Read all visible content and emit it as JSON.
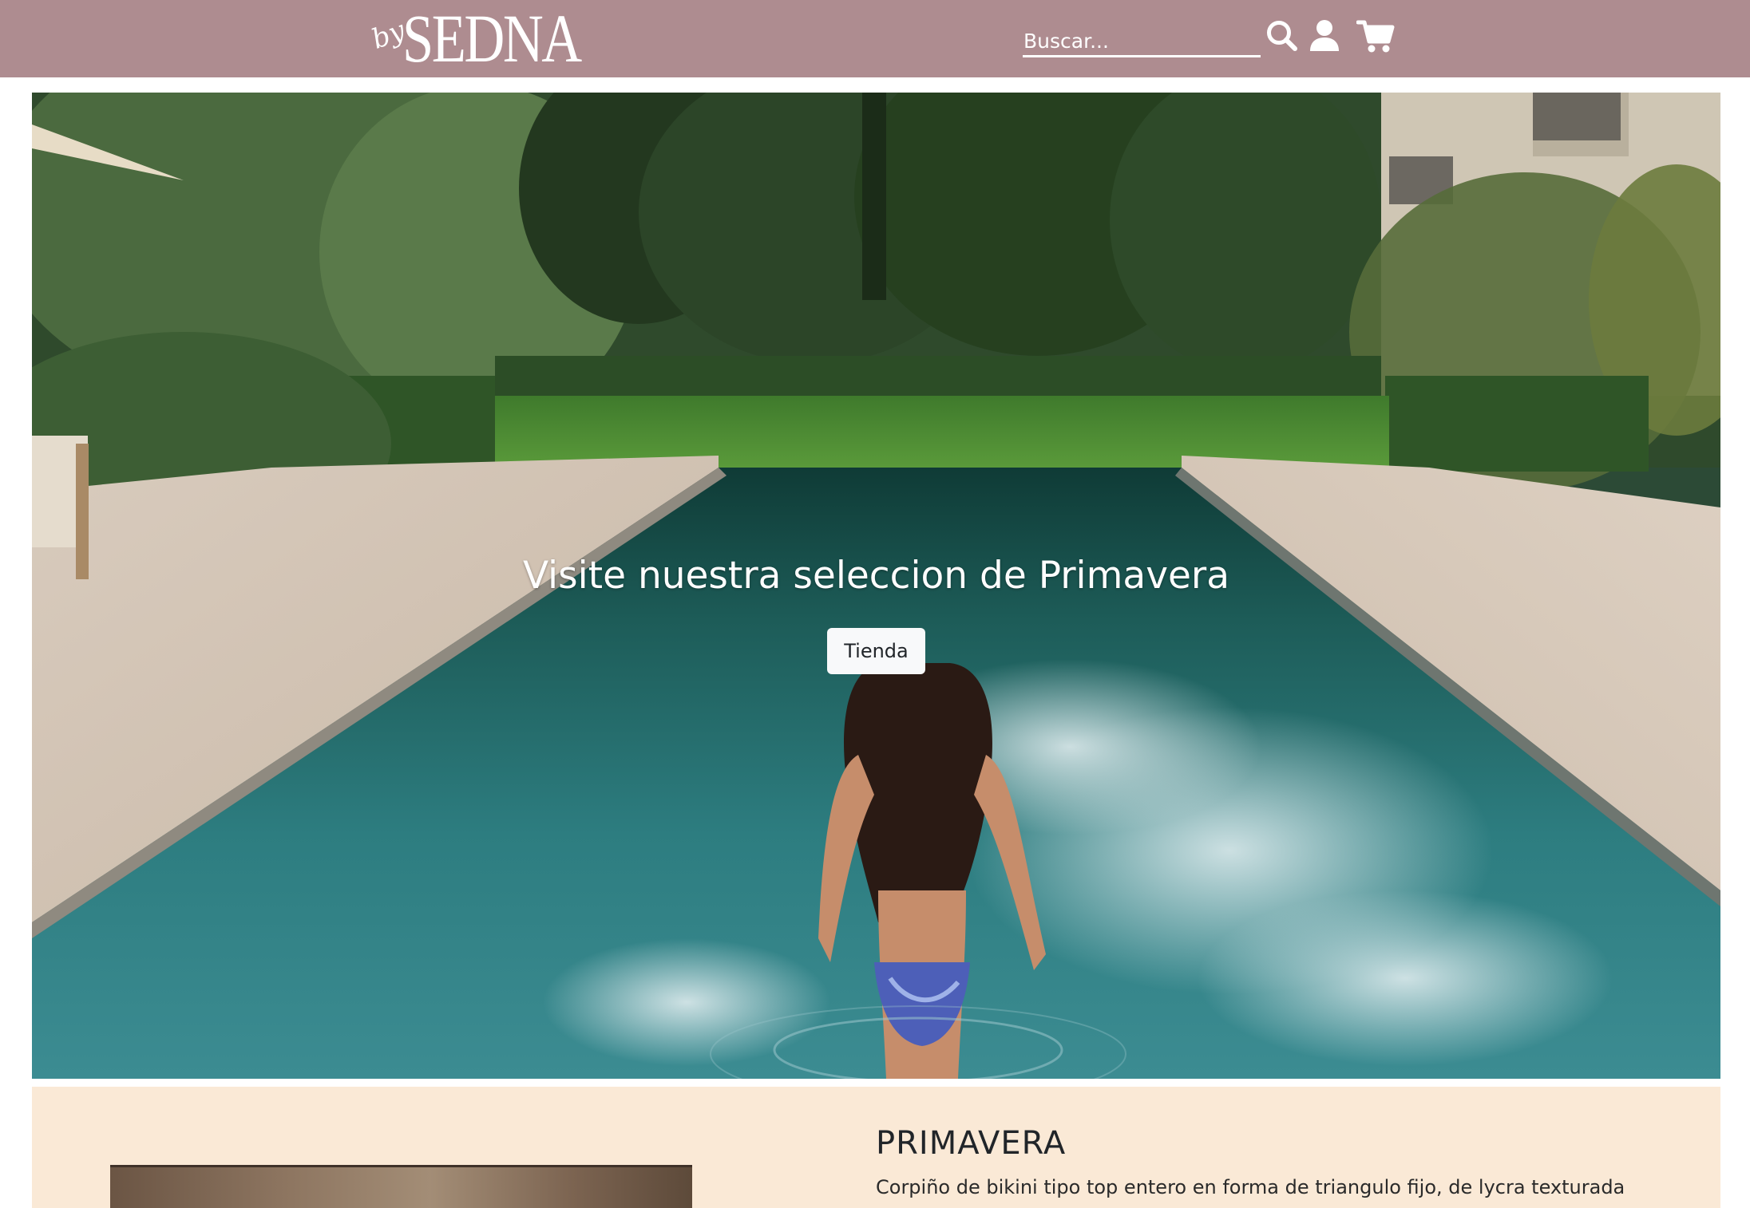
{
  "header": {
    "logo": {
      "prefix": "by",
      "name": "SEDNA"
    },
    "search": {
      "placeholder": "Buscar..."
    },
    "icons": [
      "search-icon",
      "user-icon",
      "cart-icon"
    ],
    "background_color": "#ae8c90"
  },
  "hero": {
    "heading": "Visite nuestra seleccion de Primavera",
    "button_label": "Tienda"
  },
  "product": {
    "title": "PRIMAVERA",
    "description": "Corpiño de bikini tipo top entero en forma de triangulo fijo, de lycra texturada",
    "background_color": "#fae9d6"
  }
}
